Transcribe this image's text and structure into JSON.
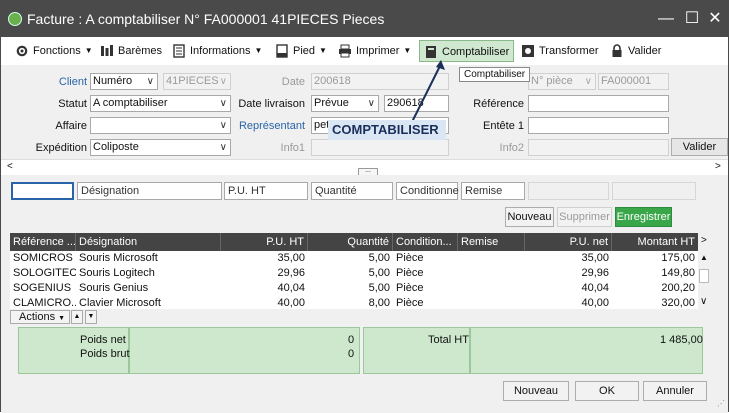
{
  "window": {
    "title": "Facture : A comptabiliser N° FA000001 41PIECES Pieces",
    "min": "—",
    "max": "☐",
    "close": "✕"
  },
  "toolbar": {
    "fonctions": "Fonctions",
    "baremes": "Barèmes",
    "informations": "Informations",
    "pied": "Pied",
    "imprimer": "Imprimer",
    "comptabiliser": "Comptabiliser",
    "transformer": "Transformer",
    "valider": "Valider",
    "tooltip": "Comptabiliser"
  },
  "form": {
    "client_label": "Client",
    "client_type": "Numéro",
    "client_value": "41PIECES",
    "statut_label": "Statut",
    "statut_value": "A comptabiliser",
    "affaire_label": "Affaire",
    "affaire_value": "",
    "expedition_label": "Expédition",
    "expedition_value": "Coliposte",
    "date_label": "Date",
    "date_value": "200618",
    "date_livraison_label": "Date livraison",
    "date_livraison_type": "Prévue",
    "date_livraison_value": "290618",
    "representant_label": "Représentant",
    "representant_value": "pet",
    "info1_label": "Info1",
    "info2_label": "Info2",
    "piece_type": "N° pièce",
    "piece_value": "FA000001",
    "reference_label": "Référence",
    "entete1_label": "Entête 1",
    "valider_button": "Valider",
    "callout": "COMPTABILISER"
  },
  "filters": {
    "designation": "Désignation",
    "puht": "P.U. HT",
    "quantite": "Quantité",
    "conditionne": "Conditionne",
    "remise": "Remise"
  },
  "grid_buttons": {
    "nouveau": "Nouveau",
    "supprimer": "Supprimer",
    "enregistrer": "Enregistrer"
  },
  "table": {
    "columns": [
      "Référence ...",
      "Désignation",
      "P.U. HT",
      "Quantité",
      "Condition...",
      "Remise",
      "P.U. net",
      "Montant HT"
    ],
    "rows": [
      [
        "SOMICROS",
        "Souris Microsoft",
        "35,00",
        "5,00",
        "Pièce",
        "",
        "35,00",
        "175,00"
      ],
      [
        "SOLOGITECH",
        "Souris Logitech",
        "29,96",
        "5,00",
        "Pièce",
        "",
        "29,96",
        "149,80"
      ],
      [
        "SOGENIUS",
        "Souris Genius",
        "40,04",
        "5,00",
        "Pièce",
        "",
        "40,04",
        "200,20"
      ],
      [
        "CLAMICRO...",
        "Clavier Microsoft",
        "40,00",
        "8,00",
        "Pièce",
        "",
        "40,00",
        "320,00"
      ]
    ]
  },
  "actions": {
    "label": "Actions"
  },
  "totals": {
    "poids_net_label": "Poids net",
    "poids_net": "0",
    "poids_brut_label": "Poids brut",
    "poids_brut": "0",
    "total_ht_label": "Total HT",
    "total_ht": "1 485,00"
  },
  "footer": {
    "nouveau": "Nouveau",
    "ok": "OK",
    "annuler": "Annuler"
  }
}
